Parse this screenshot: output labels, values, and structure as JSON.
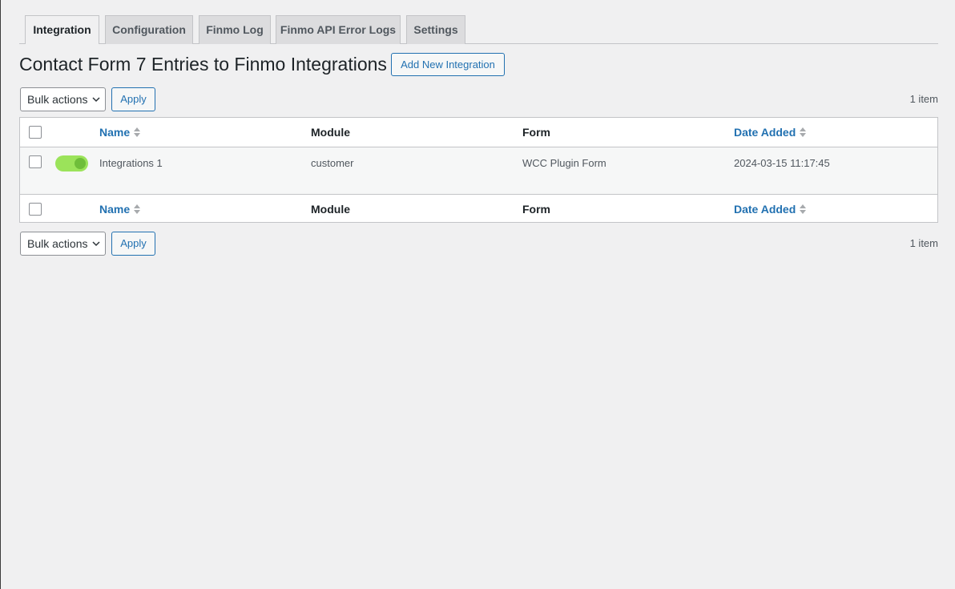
{
  "tabs": [
    {
      "label": "Integration",
      "active": true
    },
    {
      "label": "Configuration",
      "active": false
    },
    {
      "label": "Finmo Log",
      "active": false
    },
    {
      "label": "Finmo API Error Logs",
      "active": false
    },
    {
      "label": "Settings",
      "active": false
    }
  ],
  "page": {
    "title": "Contact Form 7 Entries to Finmo Integrations",
    "add_button": "Add New Integration"
  },
  "tablenav": {
    "bulk_actions": "Bulk actions",
    "apply": "Apply",
    "count": "1 item"
  },
  "table": {
    "columns": {
      "name": "Name",
      "module": "Module",
      "form": "Form",
      "date_added": "Date Added"
    },
    "rows": [
      {
        "enabled": true,
        "name": "Integrations 1",
        "module": "customer",
        "form": "WCC Plugin Form",
        "date_added": "2024-03-15 11:17:45"
      }
    ]
  },
  "colors": {
    "link": "#2271b1",
    "toggle_on": "#9be35a",
    "background": "#f0f0f1"
  }
}
